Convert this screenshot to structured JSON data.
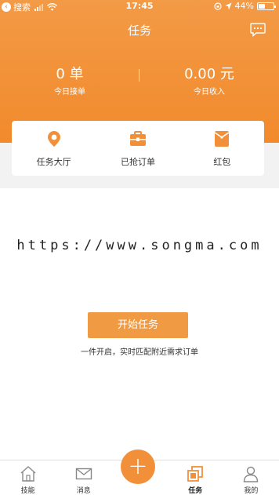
{
  "status_bar": {
    "back_app": "搜索",
    "time": "17:45",
    "battery_percent": "44%",
    "battery_level": 0.44
  },
  "header": {
    "title": "任务"
  },
  "stats": {
    "orders_value": "0 单",
    "orders_label": "今日接单",
    "income_value": "0.00 元",
    "income_label": "今日收入"
  },
  "quick_menu": {
    "items": [
      {
        "label": "任务大厅",
        "icon": "location-pin-icon"
      },
      {
        "label": "已抢订单",
        "icon": "briefcase-icon"
      },
      {
        "label": "红包",
        "icon": "red-envelope-icon"
      }
    ]
  },
  "watermark": "https://www.songma.com",
  "task": {
    "start_button": "开始任务",
    "hint": "一件开启，实时匹配附近需求订单"
  },
  "tabbar": {
    "items": [
      {
        "label": "技能",
        "icon": "home-icon"
      },
      {
        "label": "消息",
        "icon": "mail-icon"
      },
      {
        "label": "任务",
        "icon": "task-icon",
        "active": true
      },
      {
        "label": "我的",
        "icon": "profile-icon"
      }
    ],
    "fab_icon": "plus-icon"
  },
  "colors": {
    "accent": "#f2903a",
    "accent_light": "#f09a43"
  }
}
